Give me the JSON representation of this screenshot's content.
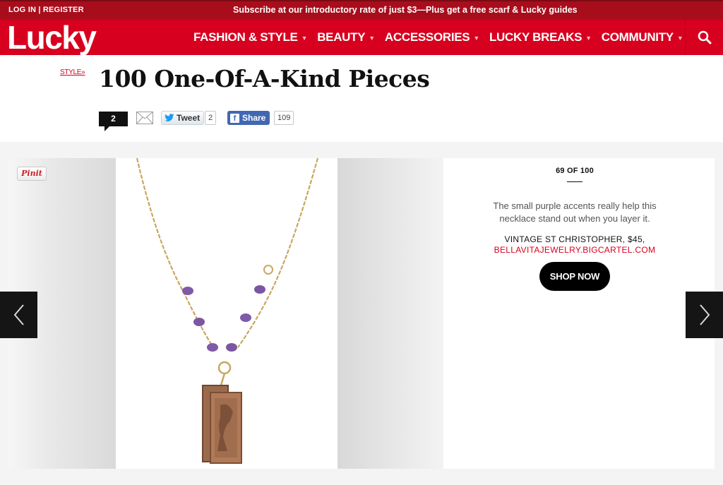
{
  "topbar": {
    "login_label": "LOG IN | REGISTER",
    "promo_text": "Subscribe at our introductory rate of just $3—Plus get a free scarf & Lucky guides"
  },
  "nav": {
    "logo": "Lucky",
    "items": [
      {
        "label": "FASHION & STYLE"
      },
      {
        "label": "BEAUTY"
      },
      {
        "label": "ACCESSORIES"
      },
      {
        "label": "LUCKY BREAKS"
      },
      {
        "label": "COMMUNITY"
      }
    ],
    "search_icon": "search-icon"
  },
  "article": {
    "breadcrumb": "STYLE»",
    "title": "100 One-Of-A-Kind Pieces"
  },
  "share": {
    "comments": "2",
    "tweet_label": "Tweet",
    "tweet_count": "2",
    "fb_label": "Share",
    "fb_count": "109"
  },
  "slide": {
    "pinit_label": "Pinit",
    "counter": "69 OF 100",
    "description": "The small purple accents really help this necklace stand out when you layer it.",
    "product": "VINTAGE ST CHRISTOPHER, $45,",
    "product_link": "BELLAVITAJEWELRY.BIGCARTEL.COM",
    "shop_button": "SHOP NOW"
  },
  "colors": {
    "brand_red": "#d7001f",
    "topbar_red": "#a80d1c",
    "link_red": "#d7001f",
    "button_black": "#000000"
  }
}
